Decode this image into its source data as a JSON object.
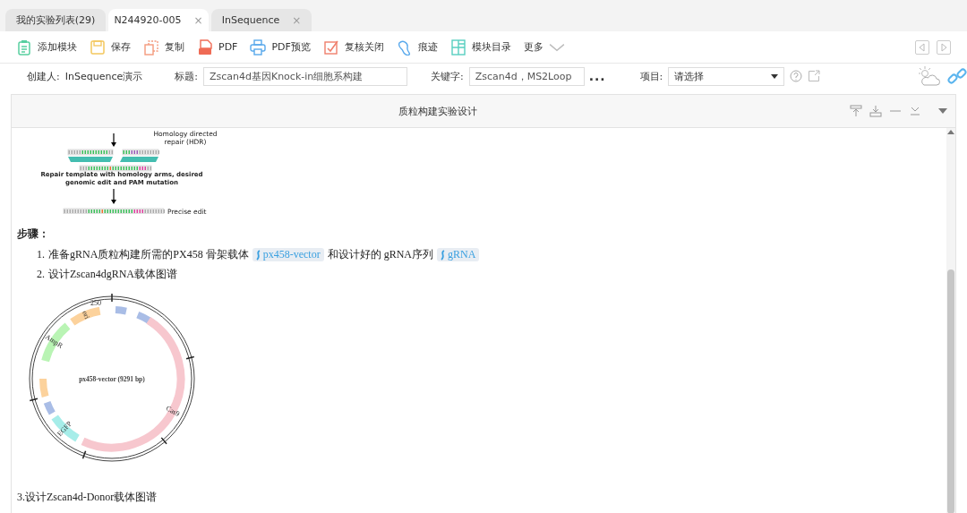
{
  "tabs": [
    {
      "label": "我的实验列表(29)",
      "selected": false
    },
    {
      "label": "N244920-005",
      "selected": true,
      "close": "×"
    },
    {
      "label": "InSequence",
      "selected": false,
      "close": "×"
    }
  ],
  "toolbar": [
    {
      "label": "添加模块",
      "kind": "clipboard"
    },
    {
      "label": "保存",
      "kind": "save"
    },
    {
      "label": "复制",
      "kind": "copy"
    },
    {
      "label": "PDF",
      "kind": "pdf"
    },
    {
      "label": "PDF预览",
      "kind": "printer"
    },
    {
      "label": "复核关闭",
      "kind": "review"
    },
    {
      "label": "痕迹",
      "kind": "trace"
    },
    {
      "label": "模块目录",
      "kind": "grid"
    },
    {
      "label": "更多",
      "kind": "more"
    }
  ],
  "info": {
    "creator_label": "创建人:",
    "creator": "InSequence演示",
    "title_label": "标题:",
    "title": "Zscan4d基因Knock-in细胞系构建",
    "keyword_label": "关键字:",
    "keywords": "Zscan4d，MS2Loop",
    "more": "...",
    "project_label": "项目:",
    "project": "请选择"
  },
  "panel": {
    "title": "质粒构建实验设计",
    "hdr_figure": {
      "step": "Homology directed repair (HDR)",
      "template": "Repair template with homology arms, desired genomic edit and PAM mutation",
      "result": "Precise edit"
    },
    "heading": "步骤：",
    "steps": [
      {
        "number": "1.",
        "parts": [
          {
            "kind": "text",
            "text": "准备gRNA质粒构建所需的PX458 骨架载体"
          },
          {
            "kind": "link",
            "text": "px458-vector"
          },
          {
            "kind": "text",
            "text": "和设计好的 gRNA序列"
          },
          {
            "kind": "link",
            "text": "gRNA"
          }
        ]
      },
      {
        "number": "2.",
        "parts": [
          {
            "kind": "text",
            "text": "设计Zscan4dgRNA载体图谱"
          }
        ]
      }
    ],
    "plasmid": {
      "name": "px458-vector (9291 bp)",
      "tick": "250",
      "features": [
        {
          "label": "ori",
          "color": "#fcd29c"
        },
        {
          "label": "AmpR",
          "color": "#b9f4b4"
        },
        {
          "label": "EGFP",
          "color": "#a6ede9"
        },
        {
          "label": "Cas9",
          "color": "#f7c7ce"
        }
      ]
    },
    "final_step": "3.设计Zscan4d-Donor载体图谱"
  }
}
